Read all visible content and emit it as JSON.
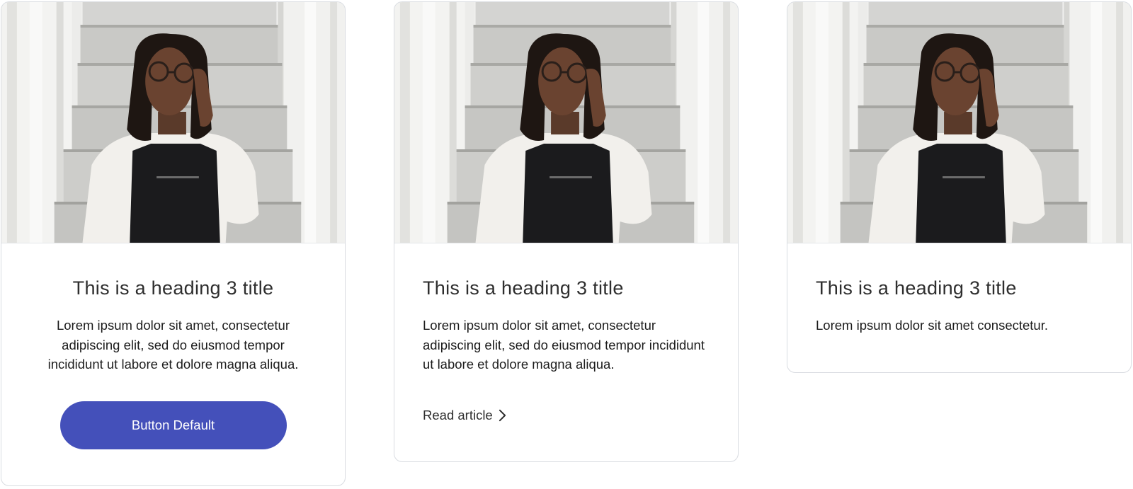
{
  "cards": [
    {
      "image": "woman-with-glasses-on-stairs-photo",
      "title": "This is a heading 3 title",
      "text": "Lorem ipsum dolor sit amet, consectetur adipiscing elit, sed do eiusmod tempor incididunt ut labore et dolore magna aliqua.",
      "button_label": "Button Default"
    },
    {
      "image": "woman-with-glasses-on-stairs-photo",
      "title": "This is a heading 3 title",
      "text": "Lorem ipsum dolor sit amet, consectetur adipiscing elit, sed do eiusmod tempor incididunt ut labore et dolore magna aliqua.",
      "link_label": "Read article",
      "link_icon": "chevron-right-icon"
    },
    {
      "image": "woman-with-glasses-on-stairs-photo",
      "title": "This is a heading 3 title",
      "text": "Lorem ipsum dolor sit amet consectetur."
    }
  ],
  "colors": {
    "button_bg": "#4450ba",
    "button_text": "#ffffff",
    "heading": "#2e2e2e",
    "card_border": "#d9dce1"
  }
}
